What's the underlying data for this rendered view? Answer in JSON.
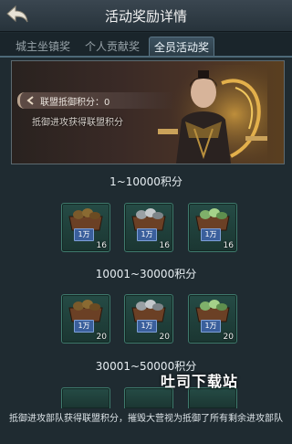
{
  "header": {
    "title": "活动奖励详情"
  },
  "tabs": [
    {
      "label": "城主坐镇奖",
      "active": false
    },
    {
      "label": "个人贡献奖",
      "active": false
    },
    {
      "label": "全员活动奖",
      "active": true
    }
  ],
  "banner": {
    "score_label": "联盟抵御积分：0",
    "description": "抵御进攻获得联盟积分"
  },
  "tiers": [
    {
      "range": "1~10000积分",
      "rewards": [
        {
          "type": "wood",
          "badge": "1万",
          "qty": "16"
        },
        {
          "type": "stone",
          "badge": "1万",
          "qty": "16"
        },
        {
          "type": "jade",
          "badge": "1万",
          "qty": "16"
        }
      ]
    },
    {
      "range": "10001~30000积分",
      "rewards": [
        {
          "type": "wood",
          "badge": "1万",
          "qty": "20"
        },
        {
          "type": "stone",
          "badge": "1万",
          "qty": "20"
        },
        {
          "type": "jade",
          "badge": "1万",
          "qty": "20"
        }
      ]
    },
    {
      "range": "30001~50000积分",
      "rewards": []
    }
  ],
  "footer": {
    "description": "抵御进攻部队获得联盟积分，摧毁大营视为抵御了所有剩余进攻部队"
  },
  "watermark": "吐司下载站"
}
